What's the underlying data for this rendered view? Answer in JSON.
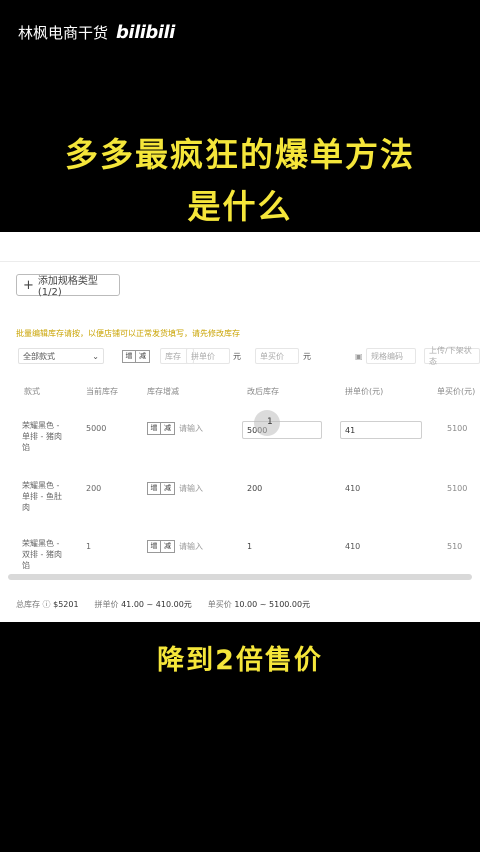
{
  "watermark": {
    "channel": "林枫电商干货",
    "logo": "bilibili"
  },
  "headline": {
    "line1": "多多最疯狂的爆单方法",
    "line2": "是什么"
  },
  "caption": "降到2倍售价",
  "colors": {
    "headline": "#f5e63a",
    "notice": "#c9a300"
  },
  "editor": {
    "add_spec_label": "添加规格类型(1/2)",
    "notice": "批量编辑库存请按，以便店铺可以正常发货填写，请先修改库存",
    "filters": {
      "select_value": "全部款式",
      "toggle": [
        "增",
        "减"
      ],
      "stock_placeholder": "库存",
      "group_price_placeholder": "拼单价",
      "group_price_unit": "元",
      "single_price_placeholder": "单买价",
      "single_price_unit": "元",
      "code_placeholder": "规格编码",
      "upload_label": "上传/下架状态"
    },
    "columns": [
      "款式",
      "当前库存",
      "库存增减",
      "改后库存",
      "拼单价(元)",
      "单买价(元)"
    ],
    "rows": [
      {
        "name": "荣耀黑色 - 单排 - 猪肉馅",
        "stock": "5000",
        "toggle": [
          "增",
          "减"
        ],
        "input_placeholder": "请输入",
        "new_stock": "5000",
        "price": "41",
        "single": "5100"
      },
      {
        "name": "荣耀黑色 - 单排 - 鱼肚肉",
        "stock": "200",
        "toggle": [
          "增",
          "减"
        ],
        "input_placeholder": "请输入",
        "new_stock": "200",
        "price": "410",
        "single": "5100"
      },
      {
        "name": "荣耀黑色 - 双排 - 猪肉馅",
        "stock": "1",
        "toggle": [
          "增",
          "减"
        ],
        "input_placeholder": "请输入",
        "new_stock": "1",
        "price": "410",
        "single": "510"
      }
    ],
    "typed_char": "1",
    "footer": {
      "total_label": "总库存",
      "total_value": "5201",
      "group_label": "拼单价",
      "group_value": "41.00 ~ 410.00元",
      "single_label": "单买价",
      "single_value": "10.00 ~ 5100.00元"
    }
  }
}
